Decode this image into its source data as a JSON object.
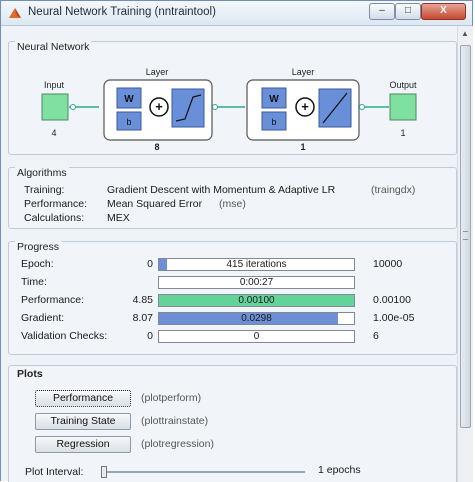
{
  "window": {
    "title": "Neural Network Training (nntraintool)",
    "controls": {
      "minimize": "–",
      "maximize": "□",
      "close": "X"
    }
  },
  "network": {
    "panel_title": "Neural Network",
    "input_label": "Input",
    "input_count": "4",
    "hidden_layer": {
      "label": "Layer",
      "w": "W",
      "b": "b",
      "sum": "+",
      "size": "8"
    },
    "output_layer": {
      "label": "Layer",
      "w": "W",
      "b": "b",
      "sum": "+",
      "size": "1"
    },
    "output_label": "Output",
    "output_count": "1"
  },
  "algorithms": {
    "panel_title": "Algorithms",
    "rows": [
      {
        "label": "Training:",
        "value": "Gradient Descent with Momentum & Adaptive LR",
        "code": "(traingdx)"
      },
      {
        "label": "Performance:",
        "value": "Mean Squared Error",
        "code": "(mse)"
      },
      {
        "label": "Calculations:",
        "value": "MEX",
        "code": ""
      }
    ]
  },
  "progress": {
    "panel_title": "Progress",
    "rows": [
      {
        "label": "Epoch:",
        "start": "0",
        "current": "415 iterations",
        "end": "10000",
        "fraction": 0.0415,
        "color": "#6e8fd6"
      },
      {
        "label": "Time:",
        "start": "",
        "current": "0:00:27",
        "end": "",
        "fraction": 0.0,
        "color": "#ffffff"
      },
      {
        "label": "Performance:",
        "start": "4.85",
        "current": "0.00100",
        "end": "0.00100",
        "fraction": 1.0,
        "color": "#63d39a"
      },
      {
        "label": "Gradient:",
        "start": "8.07",
        "current": "0.0298",
        "end": "1.00e-05",
        "fraction": 0.92,
        "color": "#6e8fd6"
      },
      {
        "label": "Validation Checks:",
        "start": "0",
        "current": "0",
        "end": "6",
        "fraction": 0.0,
        "color": "#ffffff"
      }
    ]
  },
  "plots": {
    "panel_title": "Plots",
    "buttons": [
      {
        "label": "Performance",
        "code": "(plotperform)"
      },
      {
        "label": "Training State",
        "code": "(plottrainstate)"
      },
      {
        "label": "Regression",
        "code": "(plotregression)"
      }
    ],
    "interval_label": "Plot Interval:",
    "interval_value": "1 epochs",
    "interval_fraction": 0.0
  },
  "colors": {
    "layer_block": "#6a8fd9",
    "io_block": "#7fe0a2",
    "connector": "#2ea78f"
  }
}
